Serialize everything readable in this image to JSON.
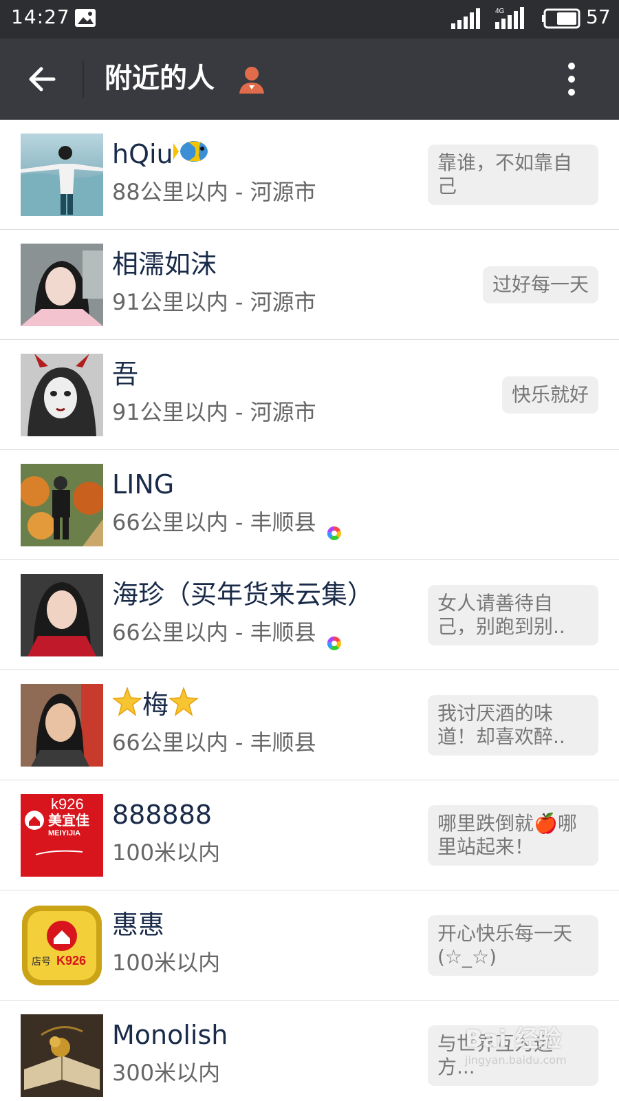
{
  "status_bar": {
    "time": "14:27",
    "battery": "57",
    "network": "4G",
    "icons": [
      "gallery-icon",
      "wifi-signal-icon",
      "cellular-signal-icon",
      "battery-icon"
    ]
  },
  "toolbar": {
    "title": "附近的人",
    "back_icon": "back-arrow-icon",
    "more_icon": "more-vertical-icon",
    "title_icon": "person-icon"
  },
  "people": [
    {
      "name": "hQiu",
      "distance": "88公里以内 - 河源市",
      "signature": "靠谁，不如靠自己",
      "name_icon": "fish-icon",
      "avatar": "sea-avatar"
    },
    {
      "name": "相濡如沫",
      "distance": "91公里以内 - 河源市",
      "signature": "过好每一天",
      "avatar": "girl-avatar"
    },
    {
      "name": "吾",
      "distance": "91公里以内 - 河源市",
      "signature": "快乐就好",
      "avatar": "horn-avatar"
    },
    {
      "name": "LING",
      "distance": "66公里以内 - 丰顺县",
      "signature": "",
      "badge": "colorful-dot-icon",
      "avatar": "child-avatar"
    },
    {
      "name": "海珍（买年货来云集）",
      "distance": "66公里以内 - 丰顺县",
      "signature": "女人请善待自己，别跑到别..",
      "badge": "colorful-dot-icon",
      "avatar": "woman-avatar"
    },
    {
      "name": "梅",
      "distance": "66公里以内 - 丰顺县",
      "signature": "我讨厌酒的味道！却喜欢醉..",
      "name_icon": "star-icon",
      "avatar": "woman2-avatar"
    },
    {
      "name": "888888",
      "distance": "100米以内",
      "signature": "哪里跌倒就🍎哪里站起来！",
      "avatar": "store-red-avatar",
      "avatar_text": [
        "k926",
        "美宜佳",
        "MEIYIJIA"
      ]
    },
    {
      "name": "惠惠",
      "distance": "100米以内",
      "signature": "开心快乐每一天(☆_☆)",
      "avatar": "store-gold-avatar",
      "avatar_text": [
        "店号",
        "K926"
      ]
    },
    {
      "name": "Monolish",
      "distance": "300米以内",
      "signature": "与世界互为远方...",
      "avatar": "book-avatar"
    }
  ],
  "watermark": {
    "title": "Bai 经验",
    "subtitle": "jingyan.baidu.com"
  },
  "colors": {
    "status_bar": "#2d2e31",
    "toolbar": "#393a3f",
    "name": "#1a2b4a",
    "signature_bg": "#efeff0",
    "accent": "#e06c4b"
  }
}
